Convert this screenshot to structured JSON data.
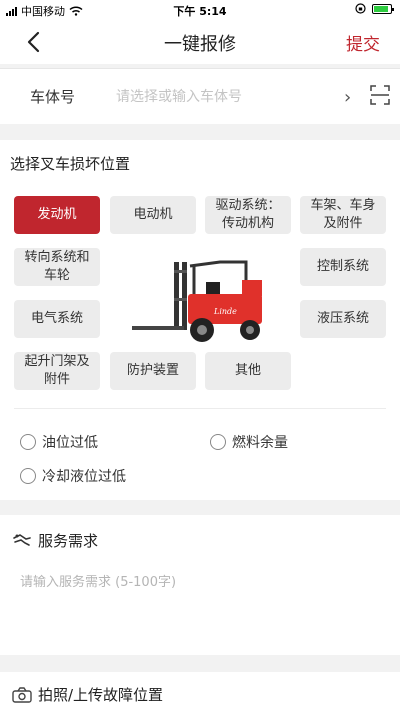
{
  "status_bar": {
    "carrier": "中国移动",
    "time": "下午 5:14"
  },
  "nav": {
    "title": "一键报修",
    "submit_label": "提交"
  },
  "vehicle": {
    "label": "车体号",
    "placeholder": "请选择或输入车体号"
  },
  "damage": {
    "title": "选择叉车损坏位置",
    "chips": [
      {
        "label": "发动机",
        "active": true
      },
      {
        "label": "电动机",
        "active": false
      },
      {
        "label": "驱动系统：传动机构",
        "active": false
      },
      {
        "label": "车架、车身及附件",
        "active": false
      },
      {
        "label": "转向系统和车轮",
        "active": false
      },
      {
        "label": "控制系统",
        "active": false
      },
      {
        "label": "电气系统",
        "active": false
      },
      {
        "label": "液压系统",
        "active": false
      },
      {
        "label": "起升门架及附件",
        "active": false
      },
      {
        "label": "防护装置",
        "active": false
      },
      {
        "label": "其他",
        "active": false
      }
    ],
    "options": [
      "油位过低",
      "燃料余量",
      "冷却液位过低"
    ],
    "forklift_brand": "Linde"
  },
  "service": {
    "title": "服务需求",
    "placeholder": "请输入服务需求 (5-100字)"
  },
  "photo": {
    "title": "拍照/上传故障位置"
  },
  "colors": {
    "accent": "#c0262e",
    "chip_bg": "#ececec",
    "page_bg": "#f2f2f2"
  }
}
